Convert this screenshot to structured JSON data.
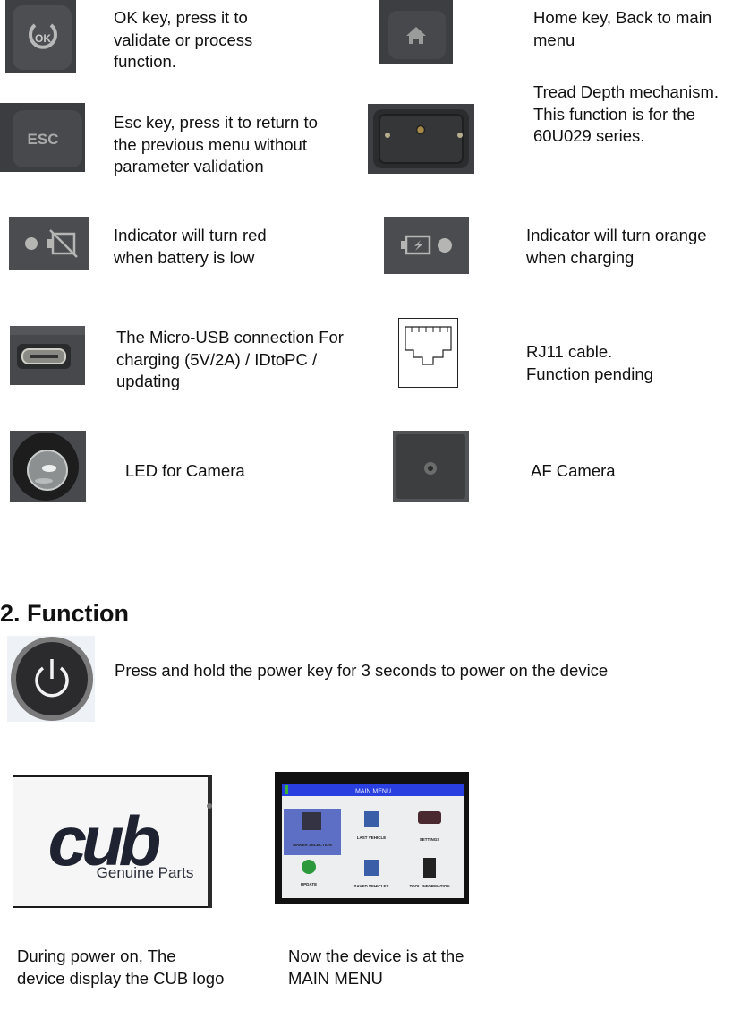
{
  "components": [
    {
      "id": "ok-key",
      "icon": "ok-key-icon",
      "description": "OK  key, press it to validate or process function."
    },
    {
      "id": "home-key",
      "icon": "home-key-icon",
      "description": "Home key, Back to main menu"
    },
    {
      "id": "esc-key",
      "icon": "esc-key-icon",
      "description": "Esc key, press it to return to the previous menu without parameter validation",
      "label": "ESC"
    },
    {
      "id": "tread-depth",
      "icon": "tread-depth-port-icon",
      "description": "Tread Depth mechanism. This function is for the 60U029 series."
    },
    {
      "id": "battery-low",
      "icon": "battery-low-indicator-icon",
      "description": "Indicator will turn red when battery is low"
    },
    {
      "id": "charging",
      "icon": "charging-indicator-icon",
      "description": "Indicator will turn orange when charging"
    },
    {
      "id": "micro-usb",
      "icon": "micro-usb-port-icon",
      "description": "The Micro-USB connection For charging (5V/2A) / IDtoPC / updating"
    },
    {
      "id": "rj11",
      "icon": "rj11-port-icon",
      "description": "RJ11 cable. Function pending"
    },
    {
      "id": "led",
      "icon": "camera-led-icon",
      "description": "LED for Camera"
    },
    {
      "id": "af-camera",
      "icon": "af-camera-icon",
      "description": "AF Camera"
    }
  ],
  "section": {
    "title": "2. Function",
    "power_instruction": "Press and hold the power key for 3 seconds to power on the device"
  },
  "screens": {
    "logo_screen": {
      "logo_text": "cub",
      "logo_tagline": "Genuine Parts",
      "caption": "During power on, The device display the CUB logo"
    },
    "main_menu_screen": {
      "title": "MAIN MENU",
      "items": [
        "MAKER SELECTION",
        "LAST VEHICLE",
        "SETTINGS",
        "UPDATE",
        "SAVED VEHICLES",
        "TOOL INFORMATION"
      ],
      "caption": "Now the device is at the MAIN MENU"
    }
  },
  "colors": {
    "menu_header_blue": "#2a3fe0",
    "menu_selected": "#5c6fc4",
    "led_red": "#d9322b",
    "led_orange": "#f39a1b",
    "key_gray": "#4a4b4e"
  }
}
